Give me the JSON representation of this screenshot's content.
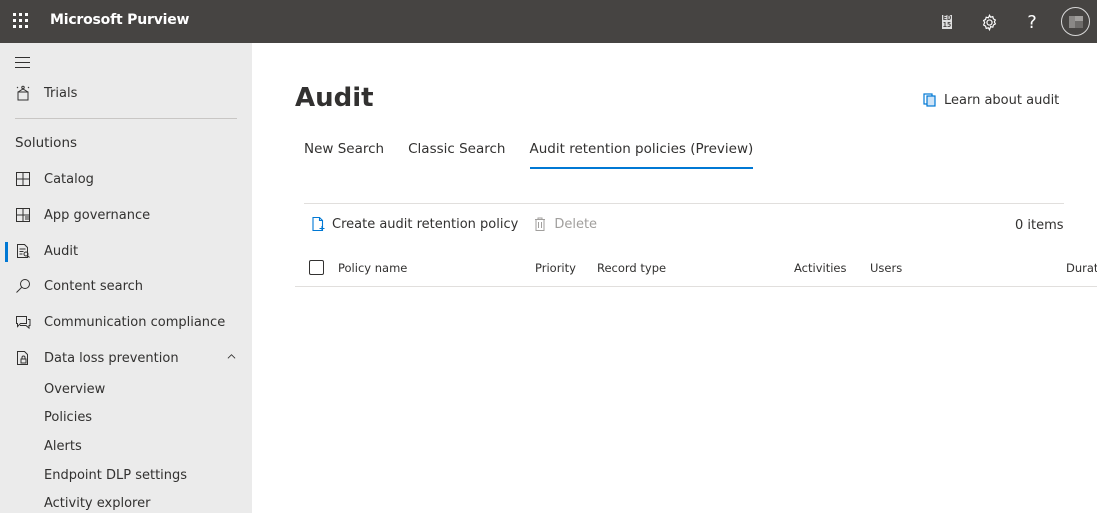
{
  "topbar": {
    "app_title": "Microsoft Purview",
    "icons": [
      "waffle-icon",
      "ed-icon",
      "gear-icon",
      "help-icon",
      "avatar"
    ],
    "help_glyph": "?",
    "ed_label_top": "ED",
    "ed_label_bottom": "15"
  },
  "sidebar": {
    "top_items": [
      {
        "label": "Trials",
        "icon": "trials-icon"
      }
    ],
    "section_label": "Solutions",
    "items": [
      {
        "label": "Catalog",
        "icon": "catalog-icon"
      },
      {
        "label": "App governance",
        "icon": "app-governance-icon"
      },
      {
        "label": "Audit",
        "icon": "audit-icon",
        "selected": true
      },
      {
        "label": "Content search",
        "icon": "search-icon"
      },
      {
        "label": "Communication compliance",
        "icon": "communication-icon"
      },
      {
        "label": "Data loss prevention",
        "icon": "dlp-icon",
        "expanded": true
      }
    ],
    "sub_items": [
      {
        "label": "Overview"
      },
      {
        "label": "Policies"
      },
      {
        "label": "Alerts"
      },
      {
        "label": "Endpoint DLP settings"
      },
      {
        "label": "Activity explorer"
      }
    ]
  },
  "main": {
    "title": "Audit",
    "learn_link": "Learn about audit",
    "tabs": [
      {
        "label": "New Search"
      },
      {
        "label": "Classic Search"
      },
      {
        "label": "Audit retention policies (Preview)",
        "active": true
      }
    ],
    "commands": {
      "create": "Create audit retention policy",
      "delete": "Delete"
    },
    "item_count": "0 items",
    "columns": [
      "Policy name",
      "Priority",
      "Record type",
      "Activities",
      "Users",
      "Durati"
    ]
  },
  "colors": {
    "topbar_bg": "#464442",
    "sidebar_bg": "#ebebeb",
    "accent": "#0078d4"
  }
}
